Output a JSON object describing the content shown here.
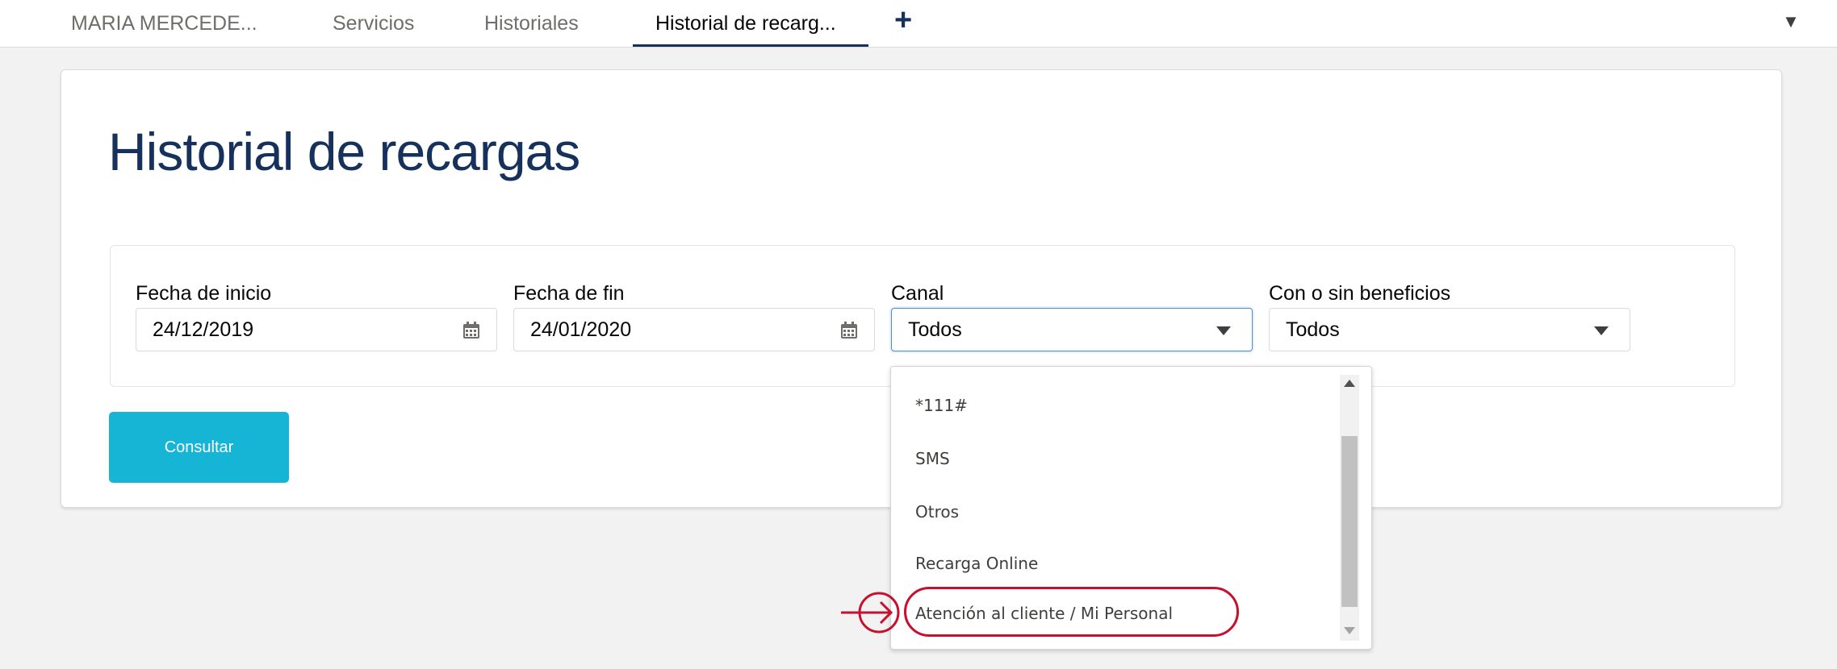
{
  "tabs": [
    {
      "label": "MARIA MERCEDE..."
    },
    {
      "label": "Servicios"
    },
    {
      "label": "Historiales"
    },
    {
      "label": "Historial de recarg..."
    }
  ],
  "page": {
    "title": "Historial de recargas"
  },
  "filters": {
    "start_date": {
      "label": "Fecha de inicio",
      "value": "24/12/2019"
    },
    "end_date": {
      "label": "Fecha de fin",
      "value": "24/01/2020"
    },
    "canal": {
      "label": "Canal",
      "value": "Todos"
    },
    "beneficios": {
      "label": "Con o sin beneficios",
      "value": "Todos"
    }
  },
  "buttons": {
    "consultar": "Consultar"
  },
  "canal_options": [
    {
      "label": "*111#"
    },
    {
      "label": "SMS"
    },
    {
      "label": "Otros"
    },
    {
      "label": "Recarga Online"
    },
    {
      "label": "Atención al cliente / Mi Personal"
    }
  ],
  "colors": {
    "accent": "#16b5d6",
    "title": "#16325c",
    "highlight": "#c8102e"
  },
  "icons": [
    "plus-icon",
    "chevron-down-icon",
    "calendar-icon",
    "caret-down-icon",
    "arrow-right-circle-icon"
  ]
}
